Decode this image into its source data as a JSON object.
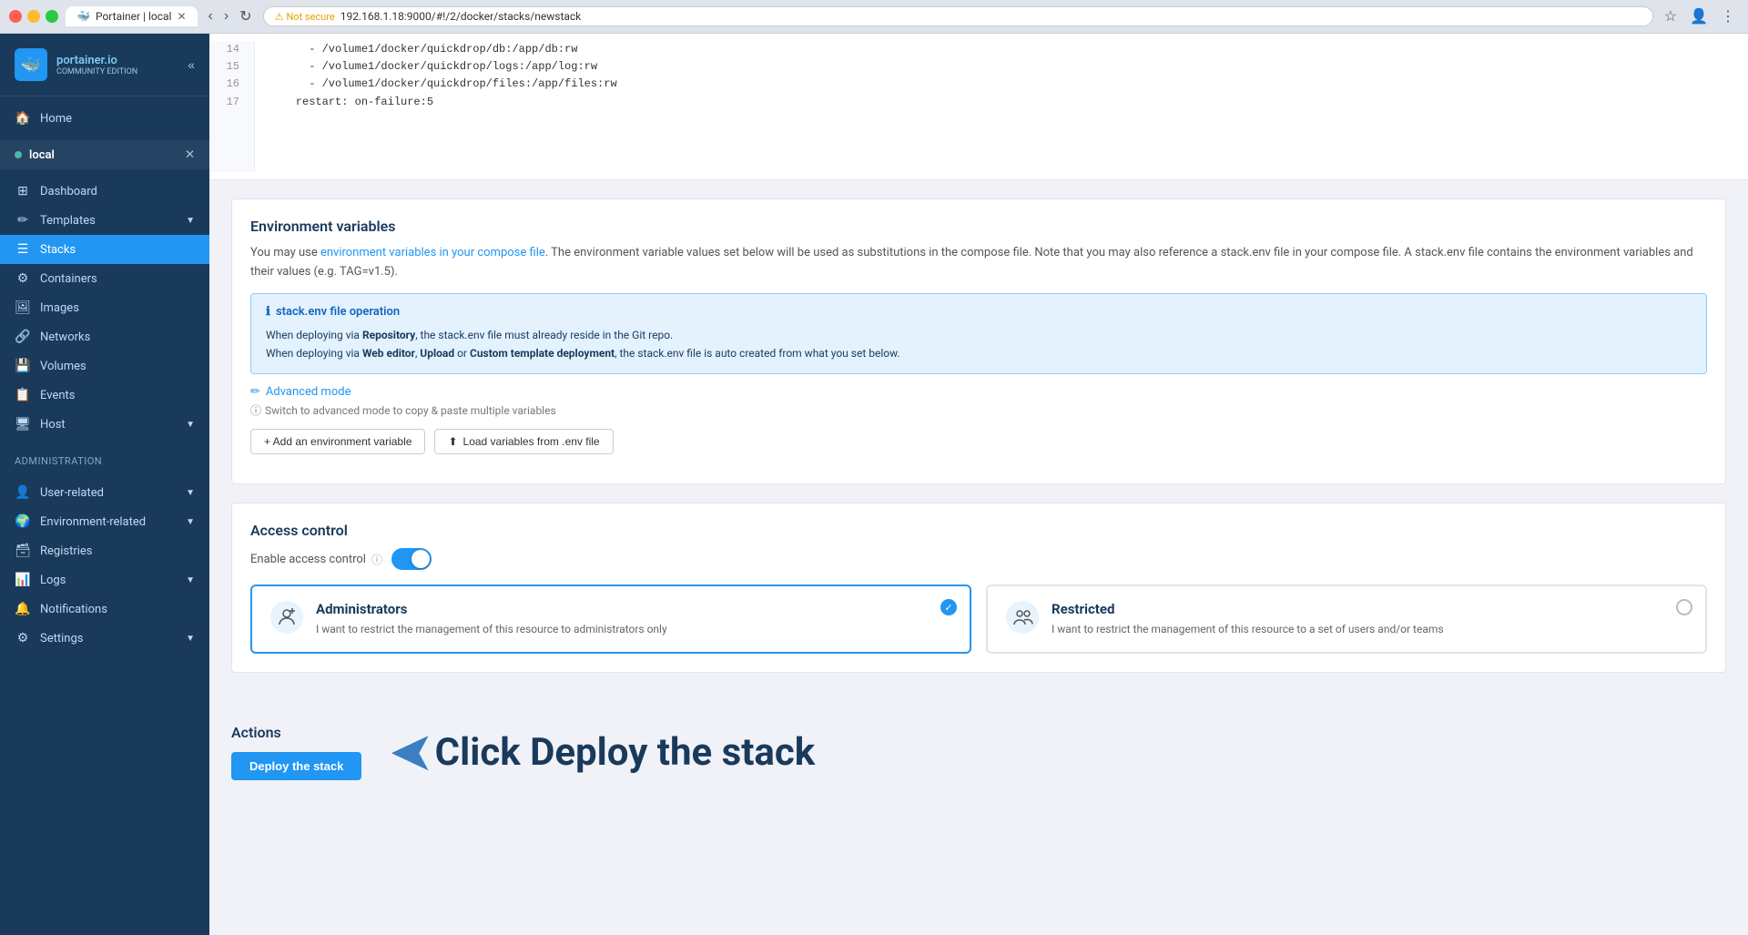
{
  "browser": {
    "tab_title": "Portainer | local",
    "address": "192.168.1.18:9000/#!/2/docker/stacks/newstack",
    "not_secure": "Not secure"
  },
  "sidebar": {
    "logo_text": "portainer.io",
    "logo_sub": "Community Edition",
    "home_label": "Home",
    "env_name": "local",
    "dashboard_label": "Dashboard",
    "templates_label": "Templates",
    "stacks_label": "Stacks",
    "containers_label": "Containers",
    "images_label": "Images",
    "networks_label": "Networks",
    "volumes_label": "Volumes",
    "events_label": "Events",
    "host_label": "Host",
    "admin_section": "Administration",
    "user_related": "User-related",
    "env_related": "Environment-related",
    "registries_label": "Registries",
    "logs_label": "Logs",
    "notifications_label": "Notifications",
    "settings_label": "Settings"
  },
  "code": {
    "lines": [
      14,
      15,
      16,
      17
    ],
    "content": [
      "      - /volume1/docker/quickdrop/db:/app/db:rw",
      "      - /volume1/docker/quickdrop/logs:/app/log:rw",
      "      - /volume1/docker/quickdrop/files:/app/files:rw",
      "    restart: on-failure:5"
    ]
  },
  "env_vars": {
    "title": "Environment variables",
    "description": "You may use ",
    "link_text": "environment variables in your compose file",
    "description2": ". The environment variable values set below will be used as substitutions in the compose file. Note that you may also reference a stack.env file in your compose file. A stack.env file contains the environment variables and their values (e.g. TAG=v1.5).",
    "info_title": "stack.env file operation",
    "info_line1_prefix": "When deploying via ",
    "info_line1_bold": "Repository",
    "info_line1_suffix": ", the stack.env file must already reside in the Git repo.",
    "info_line2_prefix": "When deploying via ",
    "info_line2_bold1": "Web editor",
    "info_line2_mid": ", ",
    "info_line2_bold2": "Upload",
    "info_line2_mid2": " or ",
    "info_line2_bold3": "Custom template deployment",
    "info_line2_suffix": ", the stack.env file is auto created from what you set below.",
    "advanced_mode_link": "Advanced mode",
    "advanced_mode_hint": "Switch to advanced mode to copy & paste multiple variables",
    "add_env_btn": "+ Add an environment variable",
    "load_env_btn": "Load variables from .env file"
  },
  "access_control": {
    "title": "Access control",
    "enable_label": "Enable access control",
    "admin_title": "Administrators",
    "admin_desc": "I want to restrict the management of this resource to administrators only",
    "restricted_title": "Restricted",
    "restricted_desc": "I want to restrict the management of this resource to a set of users and/or teams"
  },
  "actions": {
    "title": "Actions",
    "deploy_btn": "Deploy the stack",
    "annotation": "Click Deploy the stack"
  }
}
